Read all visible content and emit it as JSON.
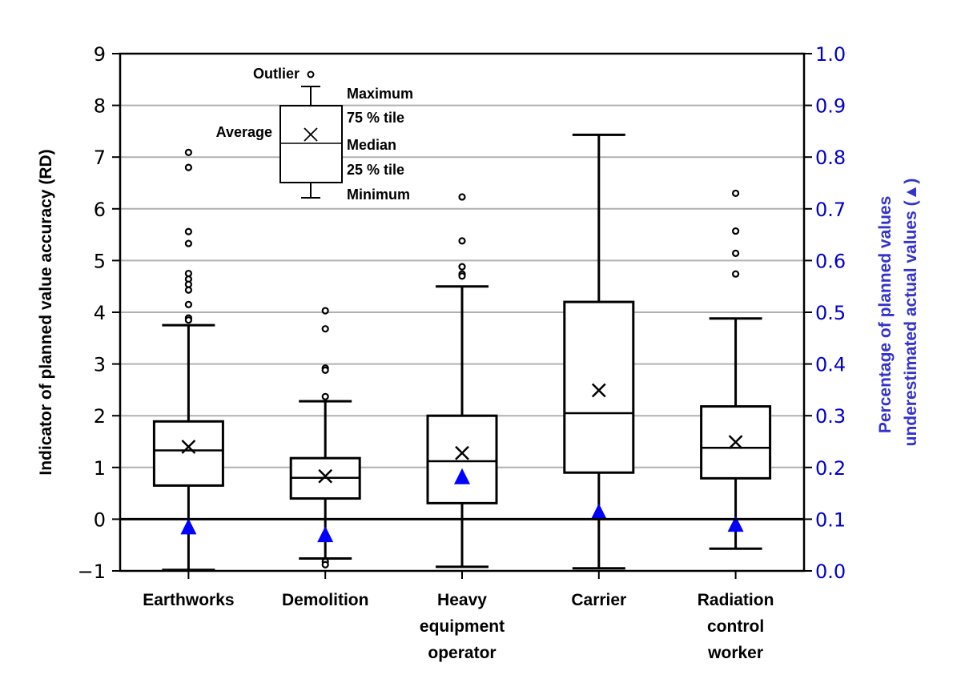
{
  "chart_data": {
    "type": "box",
    "title": "",
    "xlabel": "",
    "ylabel": "Indicator of planned value accuracy (RD)",
    "y2label_lines": [
      "Percentage of planned values",
      "underestimated actual values (▲)"
    ],
    "ylim": [
      -1,
      9
    ],
    "y2lim": [
      0.0,
      1.0
    ],
    "yticks": [
      "−1",
      "0",
      "1",
      "2",
      "3",
      "4",
      "5",
      "6",
      "7",
      "8",
      "9"
    ],
    "ytick_values": [
      -1,
      0,
      1,
      2,
      3,
      4,
      5,
      6,
      7,
      8,
      9
    ],
    "y2ticks": [
      "0.0",
      "0.1",
      "0.2",
      "0.3",
      "0.4",
      "0.5",
      "0.6",
      "0.7",
      "0.8",
      "0.9",
      "1.0"
    ],
    "y2tick_values": [
      0.0,
      0.1,
      0.2,
      0.3,
      0.4,
      0.5,
      0.6,
      0.7,
      0.8,
      0.9,
      1.0
    ],
    "grid": true,
    "reference_line_y": 0,
    "categories": [
      {
        "label_lines": [
          "Earthworks"
        ]
      },
      {
        "label_lines": [
          "Demolition"
        ]
      },
      {
        "label_lines": [
          "Heavy",
          "equipment",
          "operator"
        ]
      },
      {
        "label_lines": [
          "Carrier"
        ]
      },
      {
        "label_lines": [
          "Radiation",
          "control",
          "worker"
        ]
      }
    ],
    "boxes": [
      {
        "name": "Earthworks",
        "min": -0.98,
        "q1": 0.65,
        "median": 1.33,
        "q3": 1.89,
        "max": 3.75,
        "mean": 1.4,
        "outliers": [
          7.09,
          6.8,
          5.56,
          5.33,
          4.75,
          4.64,
          4.54,
          4.43,
          4.15,
          3.89,
          3.85
        ]
      },
      {
        "name": "Demolition",
        "min": -0.76,
        "q1": 0.4,
        "median": 0.8,
        "q3": 1.18,
        "max": 2.28,
        "mean": 0.83,
        "outliers": [
          4.03,
          3.68,
          2.92,
          2.88,
          2.37,
          -0.82,
          -0.88
        ]
      },
      {
        "name": "Heavy equipment operator",
        "min": -0.92,
        "q1": 0.31,
        "median": 1.12,
        "q3": 2.0,
        "max": 4.5,
        "mean": 1.28,
        "outliers": [
          6.23,
          5.38,
          4.88,
          4.74,
          4.7
        ]
      },
      {
        "name": "Carrier",
        "min": -0.95,
        "q1": 0.9,
        "median": 2.05,
        "q3": 4.2,
        "max": 7.43,
        "mean": 2.49,
        "outliers": []
      },
      {
        "name": "Radiation control worker",
        "min": -0.57,
        "q1": 0.79,
        "median": 1.38,
        "q3": 2.18,
        "max": 3.88,
        "mean": 1.49,
        "outliers": [
          6.3,
          5.57,
          5.14,
          4.74
        ]
      }
    ],
    "underestimated_pct": {
      "axis": "right",
      "marker": "triangle",
      "color": "#0000ff",
      "values": [
        0.083,
        0.068,
        0.18,
        0.112,
        0.088
      ]
    },
    "legend": {
      "placement": "top-left inset",
      "labels": {
        "outlier": "Outlier",
        "maximum": "Maximum",
        "q3": "75 % tile",
        "average": "Average",
        "median": "Median",
        "q1": "25 % tile",
        "minimum": "Minimum"
      }
    },
    "colors": {
      "box": "#000000",
      "grid": "#b0b0b0",
      "triangle": "#0000ff",
      "right_axis_text": "#0000cc"
    }
  }
}
